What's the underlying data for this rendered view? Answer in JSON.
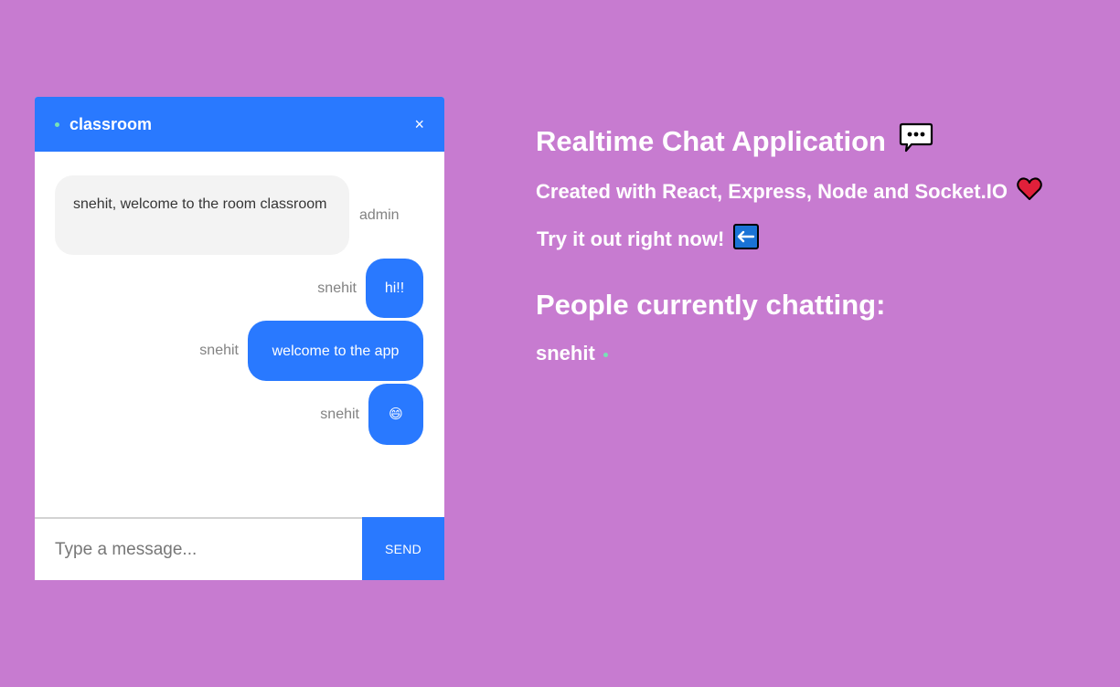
{
  "chat": {
    "room_name": "classroom",
    "close_glyph": "×",
    "messages": [
      {
        "sender": "admin",
        "text": "snehit, welcome to the room classroom",
        "mine": false
      },
      {
        "sender": "snehit",
        "text": "hi!!",
        "mine": true
      },
      {
        "sender": "snehit",
        "text": "welcome to the app",
        "mine": true
      },
      {
        "sender": "snehit",
        "text": "😄",
        "mine": true
      }
    ],
    "input_placeholder": "Type a message...",
    "send_label": "SEND"
  },
  "info": {
    "title": "Realtime Chat Application",
    "subtitle": "Created with React, Express, Node and Socket.IO",
    "cta": "Try it out right now!",
    "people_heading": "People currently chatting:",
    "users": [
      "snehit"
    ]
  },
  "colors": {
    "background": "#c77bd0",
    "accent": "#2979ff",
    "online": "#78e2b5"
  },
  "icons": {
    "title_icon": "speech-bubble-icon",
    "subtitle_icon": "heart-icon",
    "cta_icon": "left-arrow-icon"
  }
}
